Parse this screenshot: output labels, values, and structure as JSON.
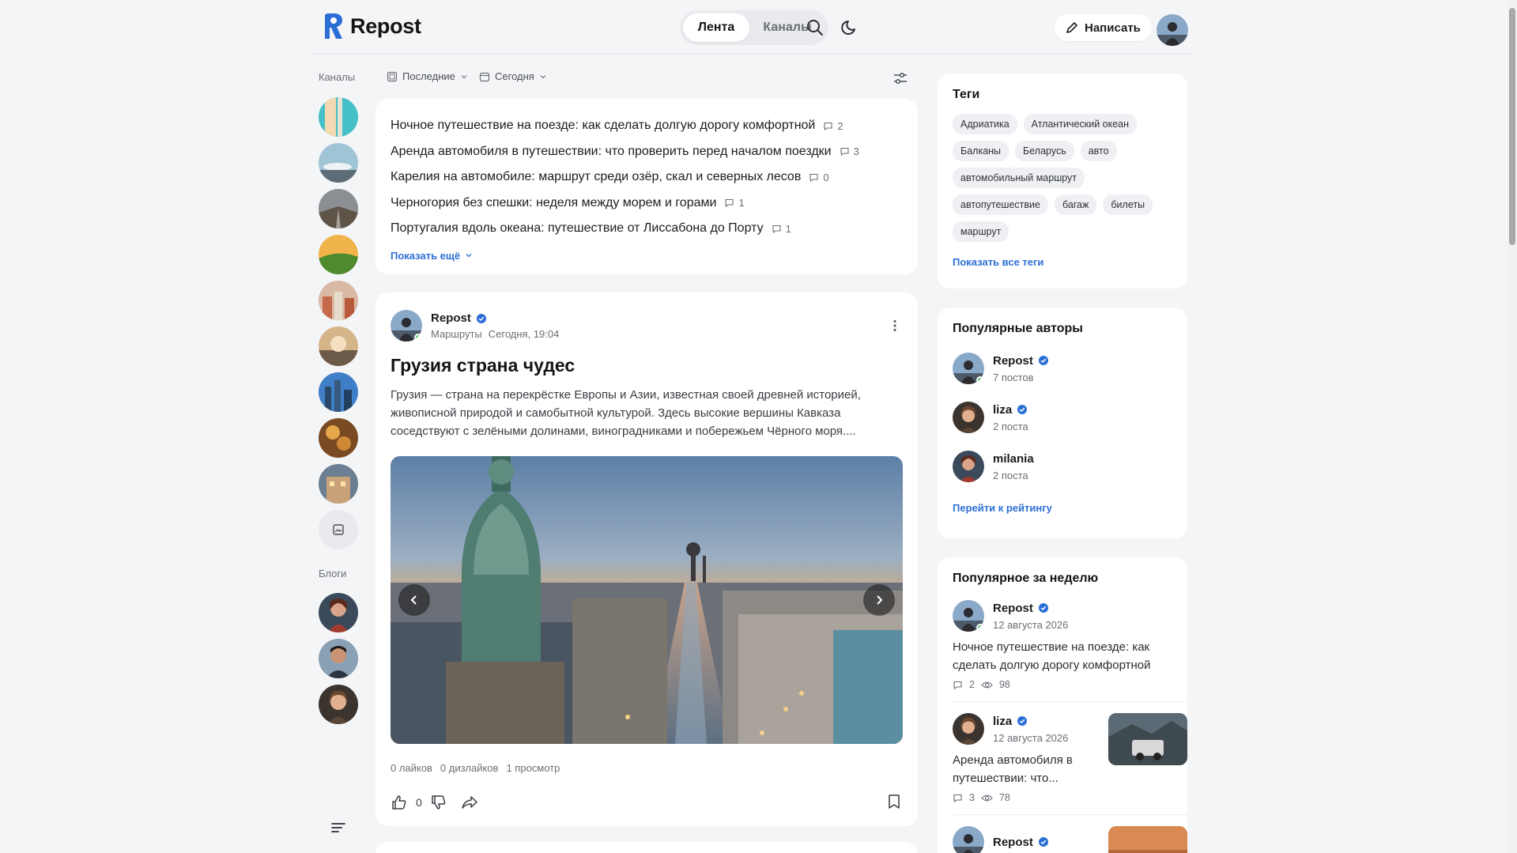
{
  "app": {
    "name": "Repost",
    "accent": "#2b6fd6"
  },
  "header": {
    "tabs": [
      {
        "label": "Лента",
        "active": true
      },
      {
        "label": "Каналы",
        "active": false
      }
    ],
    "write_label": "Написать"
  },
  "rail": {
    "channels_label": "Каналы",
    "blogs_label": "Блоги"
  },
  "filters": {
    "sort": "Последние",
    "period": "Сегодня"
  },
  "trending": {
    "items": [
      {
        "title": "Ночное путешествие на поезде: как сделать долгую дорогу комфортной",
        "comments": "2"
      },
      {
        "title": "Аренда автомобиля в путешествии: что проверить перед началом поездки",
        "comments": "3"
      },
      {
        "title": "Карелия на автомобиле: маршрут среди озёр, скал и северных лесов",
        "comments": "0"
      },
      {
        "title": "Черногория без спешки: неделя между морем и горами",
        "comments": "1"
      },
      {
        "title": "Португалия вдоль океана: путешествие от Лиссабона до Порту",
        "comments": "1"
      }
    ],
    "show_more": "Показать ещё"
  },
  "post": {
    "author": "Repost",
    "channel": "Маршруты",
    "time": "Сегодня, 19:04",
    "title": "Грузия страна чудес",
    "text": "Грузия — страна на перекрёстке Европы и Азии, известная своей древней историей, живописной природой и самобытной культурой. Здесь высокие вершины Кавказа соседствуют с зелёными долинами, виноградниками и побережьем Чёрного моря....",
    "likes_text": "0 лайков",
    "dislikes_text": "0 дизлайков",
    "views_text": "1 просмотр",
    "like_count": "0"
  },
  "tags": {
    "title": "Теги",
    "items": [
      "Адриатика",
      "Атлантический океан",
      "Балканы",
      "Беларусь",
      "авто",
      "автомобильный маршрут",
      "автопутешествие",
      "багаж",
      "билеты",
      "маршрут"
    ],
    "show_all": "Показать все теги"
  },
  "popular_authors": {
    "title": "Популярные авторы",
    "items": [
      {
        "name": "Repost",
        "sub": "7 постов"
      },
      {
        "name": "liza",
        "sub": "2 поста"
      },
      {
        "name": "milania",
        "sub": "2 поста"
      }
    ],
    "link": "Перейти к рейтингу"
  },
  "weekly": {
    "title": "Популярное за неделю",
    "items": [
      {
        "name": "Repost",
        "date": "12 августа 2026",
        "text": "Ночное путешествие на поезде: как сделать долгую дорогу комфортной",
        "comments": "2",
        "views": "98"
      },
      {
        "name": "liza",
        "date": "12 августа 2026",
        "text": "Аренда автомобиля в путешествии: что...",
        "comments": "3",
        "views": "78"
      },
      {
        "name": "Repost"
      }
    ]
  }
}
